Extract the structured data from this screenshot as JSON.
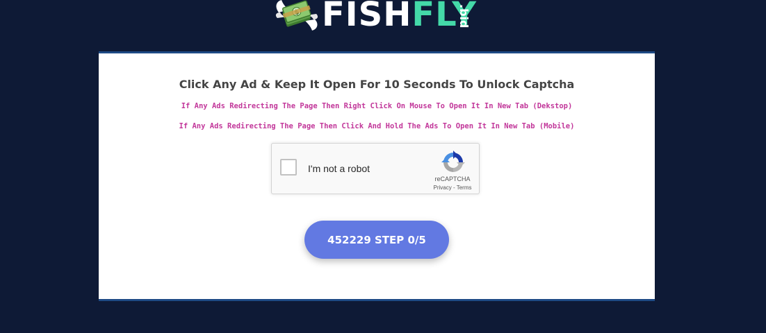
{
  "logo": {
    "brand_part1": "FISH",
    "brand_part2": "FLY",
    "tld": ".bid",
    "icon": "flying-money-icon",
    "colors": {
      "brand_part1": "#ffffff",
      "brand_part2": "#44d9a8"
    }
  },
  "card": {
    "heading": "Click Any Ad & Keep It Open For 10 Seconds To Unlock Captcha",
    "note_desktop": "If Any Ads Redirecting The Page Then Right Click On Mouse To Open It In New Tab (Dekstop)",
    "note_mobile": "If Any Ads Redirecting The Page Then Click And Hold The Ads To Open It In New Tab (Mobile)",
    "note_color": "#c2379a"
  },
  "recaptcha": {
    "label": "I'm not a robot",
    "brand": "reCAPTCHA",
    "privacy": "Privacy",
    "separator": " - ",
    "terms": "Terms",
    "icon": "recaptcha-logo-icon"
  },
  "step_button": {
    "label": "452229 STEP 0/5",
    "color": "#6279e2"
  },
  "colors": {
    "page_background": "#0e1a36",
    "card_border": "#1e4a85"
  }
}
